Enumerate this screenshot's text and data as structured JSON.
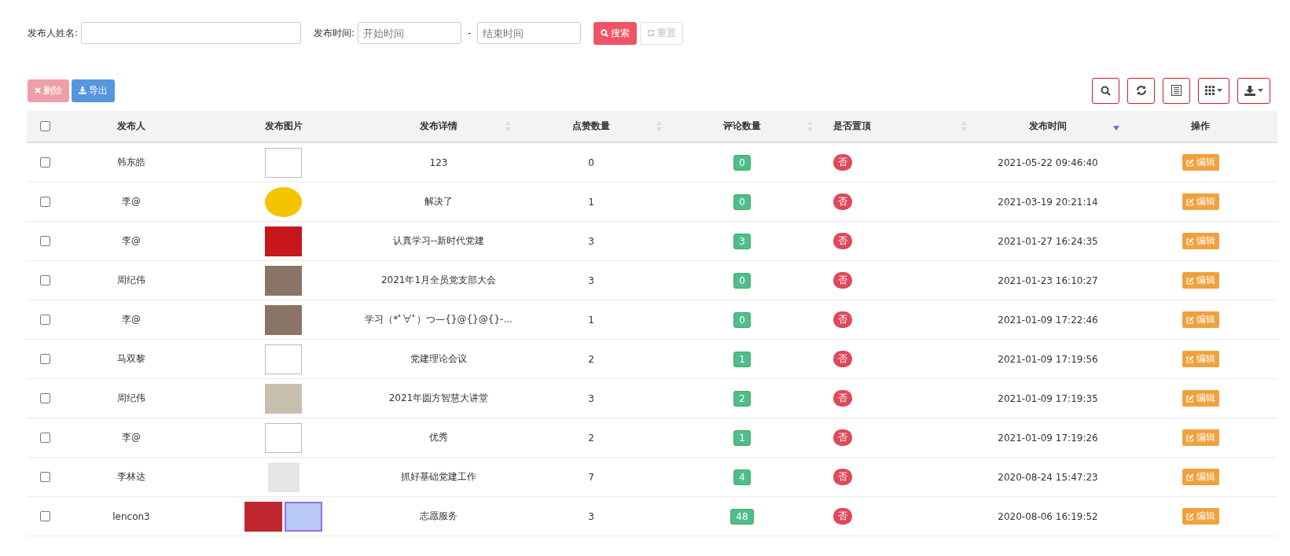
{
  "filter": {
    "name_label": "发布人姓名:",
    "time_label": "发布时间:",
    "start_placeholder": "开始时间",
    "separator": "-",
    "end_placeholder": "结束时间",
    "search_button": "搜索",
    "reset_button": {
      "label": "重置",
      "disabled": true
    }
  },
  "actions": [
    {
      "kind": "delete",
      "label": "删除",
      "disabled": true
    },
    {
      "kind": "export",
      "label": "导出",
      "disabled": false
    }
  ],
  "tools": [
    {
      "kind": "search",
      "dropdown": false
    },
    {
      "kind": "refresh",
      "dropdown": false
    },
    {
      "kind": "list",
      "dropdown": false
    },
    {
      "kind": "columns",
      "dropdown": true
    },
    {
      "kind": "download",
      "dropdown": true
    }
  ],
  "table": {
    "select_all": {
      "checked": false
    },
    "columns": [
      {
        "label": "发布人",
        "sortable": false
      },
      {
        "label": "发布图片",
        "sortable": false
      },
      {
        "label": "发布详情",
        "sortable": true,
        "sorted_descending": false
      },
      {
        "label": "点赞数量",
        "sortable": true,
        "sorted_descending": false
      },
      {
        "label": "评论数量",
        "sortable": true,
        "sorted_descending": false
      },
      {
        "label": "是否置顶",
        "sortable": true,
        "sorted_descending": false
      },
      {
        "label": "发布时间",
        "sortable": true,
        "sorted_descending": true
      },
      {
        "label": "操作",
        "sortable": false
      }
    ],
    "rows": [
      {
        "checked": false,
        "author": "韩东皓",
        "images": [
          {
            "kind": "broken"
          }
        ],
        "detail": "123",
        "likes": "0",
        "comments": "0",
        "pinned": "否",
        "time": "2021-05-22 09:46:40",
        "action": "编辑"
      },
      {
        "checked": false,
        "author": "李@",
        "images": [
          {
            "kind": "circle"
          }
        ],
        "detail": "解决了",
        "likes": "1",
        "comments": "0",
        "pinned": "否",
        "time": "2021-03-19 20:21:14",
        "action": "编辑"
      },
      {
        "checked": false,
        "author": "李@",
        "images": [
          {
            "kind": "banner"
          }
        ],
        "detail": "认真学习--新时代党建",
        "likes": "3",
        "comments": "3",
        "pinned": "否",
        "time": "2021-01-27 16:24:35",
        "action": "编辑"
      },
      {
        "checked": false,
        "author": "周纪伟",
        "images": [
          {
            "kind": "photo"
          }
        ],
        "detail": "2021年1月全员党支部大会",
        "likes": "3",
        "comments": "0",
        "pinned": "否",
        "time": "2021-01-23 16:10:27",
        "action": "编辑"
      },
      {
        "checked": false,
        "author": "李@",
        "images": [
          {
            "kind": "photo"
          }
        ],
        "detail": "学习（*ﾟ∀ﾟ）つ—{}@{}@{}-...",
        "likes": "1",
        "comments": "0",
        "pinned": "否",
        "time": "2021-01-09 17:22:46",
        "action": "编辑"
      },
      {
        "checked": false,
        "author": "马双黎",
        "images": [
          {
            "kind": "broken"
          }
        ],
        "detail": "党建理论会议",
        "likes": "2",
        "comments": "1",
        "pinned": "否",
        "time": "2021-01-09 17:19:56",
        "action": "编辑"
      },
      {
        "checked": false,
        "author": "周纪伟",
        "images": [
          {
            "kind": "plaque"
          }
        ],
        "detail": "2021年圆方智慧大讲堂",
        "likes": "3",
        "comments": "2",
        "pinned": "否",
        "time": "2021-01-09 17:19:35",
        "action": "编辑"
      },
      {
        "checked": false,
        "author": "李@",
        "images": [
          {
            "kind": "broken"
          }
        ],
        "detail": "优秀",
        "likes": "2",
        "comments": "1",
        "pinned": "否",
        "time": "2021-01-09 17:19:26",
        "action": "编辑"
      },
      {
        "checked": false,
        "author": "李林达",
        "images": [
          {
            "kind": "document"
          }
        ],
        "detail": "抓好基础党建工作",
        "likes": "7",
        "comments": "4",
        "pinned": "否",
        "time": "2020-08-24 15:47:23",
        "action": "编辑"
      },
      {
        "checked": false,
        "author": "lencon3",
        "images": [
          {
            "kind": "logo-red"
          },
          {
            "kind": "logo-blue"
          }
        ],
        "detail": "志愿服务",
        "likes": "3",
        "comments": "48",
        "pinned": "否",
        "time": "2020-08-06 16:19:52",
        "action": "编辑"
      }
    ]
  }
}
